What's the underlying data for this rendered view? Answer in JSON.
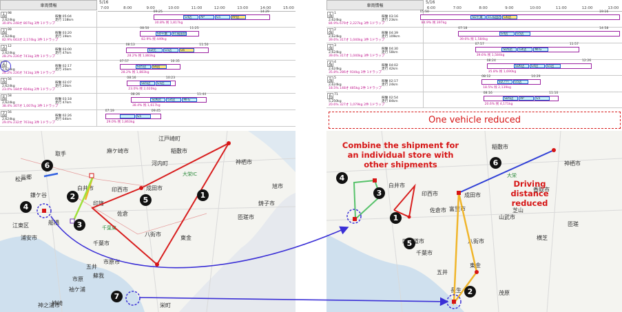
{
  "header": {
    "vehicle_info": "車両情報",
    "date": "5/16",
    "times_left": [
      "7:00",
      "8:00",
      "9:00",
      "10:00",
      "11:00",
      "12:00",
      "13:00",
      "14:00",
      "15:00"
    ],
    "times_right": [
      "6:00",
      "7:00",
      "8:00",
      "9:00",
      "10:00",
      "11:00",
      "12:00",
      "13:00"
    ]
  },
  "left_rows": [
    {
      "num": "1",
      "l1": "98",
      "l2": "04",
      "weight": "2,624kg",
      "depart": "稼働 05:04",
      "run": "走行 118km",
      "ln4": "30.8% 248才 807kg 3件 1ドラップ",
      "start": "09:25",
      "end": "14:29",
      "segs": [
        "G4店",
        "AP",
        "G5",
        "AP店"
      ],
      "stat": "30.8% 残 1,817kg"
    },
    {
      "num": "2",
      "l1": "99",
      "l2": "04",
      "weight": "2,624kg",
      "depart": "稼働 03:20",
      "run": "走行 19km",
      "ln4": "82.9% 663才 2,174kg 3件 1ドラップ",
      "start": "08:50",
      "end": "11:25",
      "segs": [
        "SD千葉",
        "EC成田店"
      ],
      "stat": "82.9% 残 449kg"
    },
    {
      "num": "3",
      "l1": "12",
      "l2": "04",
      "weight": "2,624kg",
      "depart": "稼働 03:00",
      "run": "走行 47km",
      "ln4": "28.2% 226才 741kg 3件 1ドラップ",
      "start": "08:13",
      "end": "11:50",
      "segs": [
        "SD元",
        "G5店",
        "G6"
      ],
      "stat": "28.2% 残 1,883kg"
    },
    {
      "num": "4",
      "l1": "",
      "l2": "04",
      "weight": "2,624kg",
      "depart": "稼働 02:17",
      "run": "走行 35km",
      "ln4": "28.2% 226才 741kg 3件 1ドラップ",
      "start": "07:57",
      "end": "10:35",
      "segs": [
        "SD5店",
        "G6店"
      ],
      "stat": "28.2% 残 1,883kg"
    },
    {
      "num": "5",
      "l1": "56",
      "l2": "04",
      "weight": "2,624kg",
      "depart": "稼働 02:07",
      "run": "走行 20km",
      "ln4": "23.0% 184才 604kg 2件 1ドラップ",
      "start": "08:16",
      "end": "10:23",
      "segs": [
        "SD5店",
        "G5店"
      ],
      "stat": "23.0% 残 2,020kg"
    },
    {
      "num": "6",
      "l1": "58",
      "l2": "04",
      "weight": "2,624kg",
      "depart": "稼働 03:18",
      "run": "走行 47km",
      "ln4": "38.4% 307才 1,007kg 3件 1ドラップ",
      "start": "08:26",
      "end": "11:44",
      "segs": [
        "SD6店",
        "G4店",
        "MFG"
      ],
      "stat": "38.4% 残 1,617kg"
    },
    {
      "num": "7",
      "l1": "56",
      "l2": "04",
      "weight": "2,624kg",
      "depart": "稼働 02:26",
      "run": "走行 64km",
      "ln4": "29.0% 232才 761kg 3件 1ドラップ",
      "start": "07:19",
      "end": "09:45",
      "segs": [
        "",
        "G5"
      ],
      "stat": "29.0% 残 1,863kg"
    }
  ],
  "right_rows": [
    {
      "num": "1",
      "l1": "1",
      "l2": "04",
      "weight": "2,624kg",
      "depart": "稼働 03:16",
      "run": "走行 23km",
      "ln4": "84.9% 679才 2,227kg 3件 1ドラップ",
      "start": "05:50",
      "end": "19:16",
      "segs": [
        "SD千葉",
        "EC成田店",
        "G6店"
      ],
      "stat": "84.9% 残 397kg"
    },
    {
      "num": "2",
      "l1": "2",
      "l2": "04",
      "weight": "2,624kg",
      "depart": "稼働 04:39",
      "run": "走行 109km",
      "ln4": "39.6% 317才 1,040kg 3件 1ドラップ",
      "start": "07:18",
      "end": "14:58",
      "segs": [
        "G4店",
        "G5店"
      ],
      "stat": "39.6% 残 1,584kg"
    },
    {
      "num": "3",
      "l1": "3",
      "l2": "04",
      "weight": "2,624kg",
      "depart": "稼働 04:30",
      "run": "走行 58km",
      "ln4": "39.6% 317才 1,040kg 3件 1ドラップ",
      "start": "07:57",
      "end": "11:57",
      "segs": [
        "SD5店",
        "G4店",
        "MFG"
      ],
      "stat": "39.6% 残 1,584kg"
    },
    {
      "num": "4",
      "l1": "4",
      "l2": "04",
      "weight": "2,624kg",
      "depart": "稼働 04:02",
      "run": "走行 42km",
      "ln4": "35.8% 286才 934kg 3件 1ドラップ",
      "start": "08:24",
      "end": "12:26",
      "segs": [
        "SD6店",
        "G4店",
        "G5店"
      ],
      "stat": "35.8% 残 1,690kg"
    },
    {
      "num": "5",
      "l1": "5",
      "l2": "04",
      "weight": "2,624kg",
      "depart": "稼働 02:17",
      "run": "走行 24km",
      "ln4": "18.5% 148才 485kg 2件 1ドラップ",
      "start": "08:12",
      "end": "10:29",
      "segs": [
        "SDアバ",
        "G5店"
      ],
      "stat": "18.5% 残 2,139kg"
    },
    {
      "num": "6",
      "l1": "71",
      "l2": "10",
      "weight": "5,250kg",
      "depart": "稼働 02:54",
      "run": "走行 84km",
      "ln4": "20.6% 327才 1,079kg 2件 1ドラップ",
      "start": "08:16",
      "end": "11:10",
      "segs": [
        "SD5店",
        "AP",
        "G5"
      ],
      "stat": "20.6% 残 4,171kg"
    }
  ],
  "reduced_label": "One vehicle reduced",
  "map_left": {
    "labels": [
      "江戸崎町",
      "稲敷市",
      "神栖市",
      "麻ケ崎市",
      "河内町",
      "取手",
      "白井市",
      "印西市",
      "成田市",
      "大栄IC",
      "鎌ケ谷",
      "船橋",
      "佐倉",
      "八街市",
      "東金",
      "千葉市",
      "市原市",
      "袖ケ浦",
      "鋳子市",
      "匝瑳市",
      "松戸",
      "江東区",
      "浦安市",
      "旭市",
      "千葉東",
      "蘇我",
      "五井",
      "市原",
      "姉崎",
      "神之浦市",
      "三郷",
      "印旛",
      "栄町"
    ],
    "badges": [
      "1",
      "2",
      "3",
      "4",
      "5",
      "6",
      "7"
    ]
  },
  "map_right": {
    "labels": [
      "成田市",
      "印西市",
      "白井市",
      "佐倉市",
      "東金",
      "富里市",
      "山武市",
      "八街市",
      "茂原",
      "四街道市",
      "千葉市",
      "長生",
      "五井",
      "稲敷市",
      "神栖市",
      "大栄",
      "香取市",
      "芝山",
      "横芝",
      "匝瑳"
    ],
    "badges": [
      "1",
      "2",
      "3",
      "4",
      "5",
      "6"
    ],
    "annot_combine": "Combine the shipment for an individual store with other shipments",
    "annot_driving": "Driving distance reduced"
  },
  "colors": {
    "red": "#d61515",
    "blue": "#3a2fd6",
    "orange": "#f0b52a",
    "green": "#56c26a",
    "lime": "#9fe03a",
    "route_red": "#d81e1e"
  }
}
